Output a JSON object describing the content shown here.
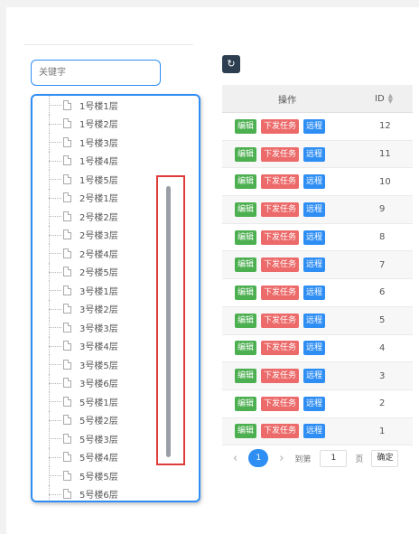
{
  "search": {
    "placeholder": "关键字"
  },
  "tree": {
    "items": [
      "1号楼1层",
      "1号楼2层",
      "1号楼3层",
      "1号楼4层",
      "1号楼5层",
      "2号楼1层",
      "2号楼2层",
      "2号楼3层",
      "2号楼4层",
      "2号楼5层",
      "3号楼1层",
      "3号楼2层",
      "3号楼3层",
      "3号楼4层",
      "3号楼5层",
      "3号楼6层",
      "5号楼1层",
      "5号楼2层",
      "5号楼3层",
      "5号楼4层",
      "5号楼5层",
      "5号楼6层"
    ]
  },
  "toolbar": {
    "refresh_icon": "↻"
  },
  "table": {
    "headers": {
      "ops": "操作",
      "id": "ID"
    },
    "buttons": {
      "edit": "编辑",
      "task": "下发任务",
      "remote": "远程"
    },
    "rows": [
      {
        "id": "12"
      },
      {
        "id": "11"
      },
      {
        "id": "10"
      },
      {
        "id": "9"
      },
      {
        "id": "8"
      },
      {
        "id": "7"
      },
      {
        "id": "6"
      },
      {
        "id": "5"
      },
      {
        "id": "4"
      },
      {
        "id": "3"
      },
      {
        "id": "2"
      },
      {
        "id": "1"
      }
    ]
  },
  "pager": {
    "prev": "‹",
    "current": "1",
    "next": "›",
    "goto_label": "到第",
    "page_value": "1",
    "page_label": "页",
    "confirm": "确定"
  },
  "colors": {
    "accent": "#2f8ef4",
    "edit": "#4caf50",
    "task": "#ec6a6a",
    "highlight": "#e03b3b"
  }
}
